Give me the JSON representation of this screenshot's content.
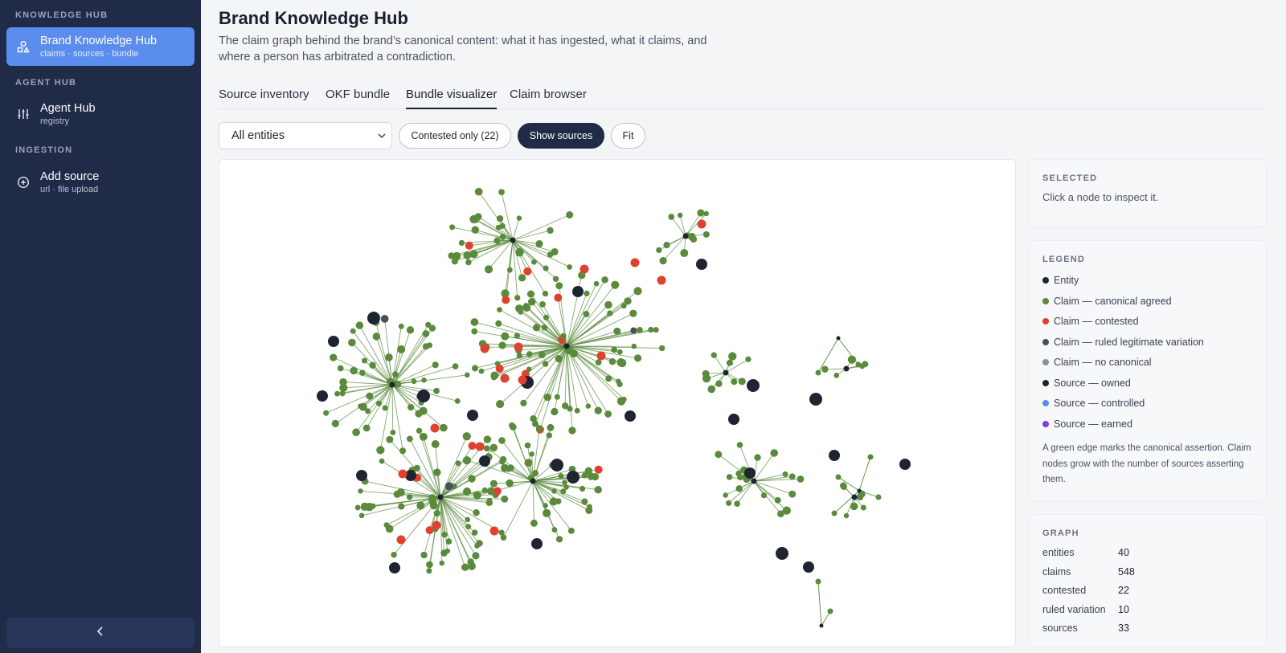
{
  "sidebar": {
    "sections": [
      {
        "label": "KNOWLEDGE HUB"
      },
      {
        "label": "AGENT HUB"
      },
      {
        "label": "INGESTION"
      }
    ],
    "items": [
      {
        "title": "Brand Knowledge Hub",
        "subtitle": "claims · sources · bundle",
        "icon": "shapes-icon",
        "active": true
      },
      {
        "title": "Agent Hub",
        "subtitle": "registry",
        "icon": "sliders-icon",
        "active": false
      },
      {
        "title": "Add source",
        "subtitle": "url · file upload",
        "icon": "plus-circle-icon",
        "active": false
      }
    ],
    "collapse_icon": "chevron-left-icon"
  },
  "page": {
    "title": "Brand Knowledge Hub",
    "subtitle": "The claim graph behind the brand’s canonical content: what it has ingested, what it claims, and where a person has arbitrated a contradiction."
  },
  "tabs": [
    {
      "label": "Source inventory",
      "active": false
    },
    {
      "label": "OKF bundle",
      "active": false
    },
    {
      "label": "Bundle visualizer",
      "active": true
    },
    {
      "label": "Claim browser",
      "active": false
    }
  ],
  "controls": {
    "entity_select": "All entities",
    "contested_label": "Contested only (22)",
    "sources_label": "Show sources",
    "fit_label": "Fit"
  },
  "selected": {
    "heading": "SELECTED",
    "hint": "Click a node to inspect it."
  },
  "legend": {
    "heading": "LEGEND",
    "items": [
      {
        "label": "Entity",
        "color": "#1f2433"
      },
      {
        "label": "Claim — canonical agreed",
        "color": "#5a8a3c"
      },
      {
        "label": "Claim — contested",
        "color": "#e0412e"
      },
      {
        "label": "Claim — ruled legitimate variation",
        "color": "#4a4f5a"
      },
      {
        "label": "Claim — no canonical",
        "color": "#8a8f99"
      },
      {
        "label": "Source — owned",
        "color": "#1f2433"
      },
      {
        "label": "Source — controlled",
        "color": "#5b8def"
      },
      {
        "label": "Source — earned",
        "color": "#7b3fe4"
      }
    ],
    "note": "A green edge marks the canonical assertion. Claim nodes grow with the number of sources asserting them."
  },
  "graph_stats": {
    "heading": "GRAPH",
    "rows": [
      {
        "label": "entities",
        "value": "40"
      },
      {
        "label": "claims",
        "value": "548"
      },
      {
        "label": "contested",
        "value": "22"
      },
      {
        "label": "ruled variation",
        "value": "10"
      },
      {
        "label": "sources",
        "value": "33"
      }
    ]
  },
  "colors": {
    "sidebar_bg": "#1f2b47",
    "active_item": "#5b8def",
    "agreed": "#5a8a3c",
    "contested": "#e0412e",
    "entity": "#1f2433",
    "variation": "#4a4f5a",
    "no_canonical": "#8a8f99",
    "earned": "#7b3fe4"
  }
}
